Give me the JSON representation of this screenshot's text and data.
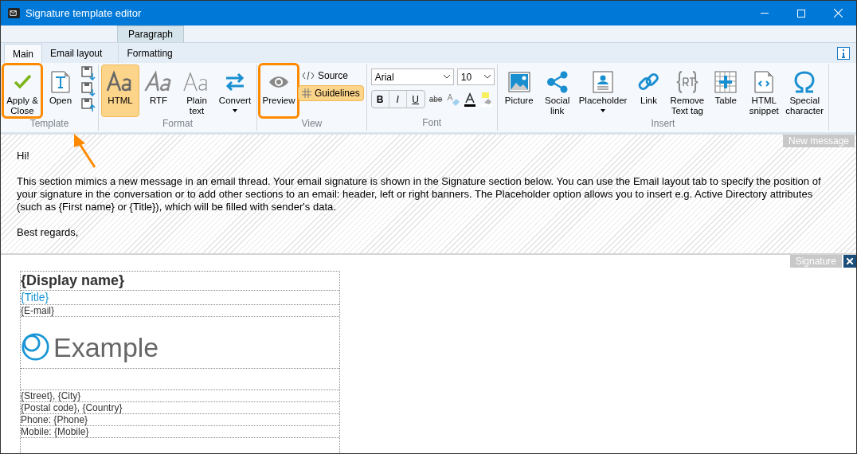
{
  "window": {
    "title": "Signature template editor"
  },
  "context_tab": {
    "label": "Paragraph"
  },
  "tabs": [
    {
      "label": "Main",
      "selected": true
    },
    {
      "label": "Email layout",
      "selected": false
    },
    {
      "label": "Formatting",
      "selected": false
    }
  ],
  "ribbon": [
    {
      "label": "Template",
      "items": [
        {
          "kind": "large",
          "label": "Apply & Close",
          "highlighted": true
        },
        {
          "kind": "large",
          "label": "Open",
          "highlighted": false
        },
        {
          "kind": "stack"
        }
      ]
    },
    {
      "label": "Format",
      "items": [
        {
          "kind": "large",
          "label": "HTML",
          "selected": true
        },
        {
          "kind": "large",
          "label": "RTF",
          "selected": false
        },
        {
          "kind": "large",
          "label": "Plain text",
          "selected": false
        },
        {
          "kind": "dropdown",
          "label": "Convert"
        }
      ]
    },
    {
      "label": "View",
      "items": [
        {
          "kind": "large",
          "label": "Preview",
          "highlighted": true
        },
        {
          "kind": "toggles",
          "toggles": [
            {
              "label": "Source",
              "selected": false
            },
            {
              "label": "Guidelines",
              "selected": true
            }
          ]
        }
      ]
    },
    {
      "label": "Font",
      "items": [
        {
          "kind": "font",
          "font": "Arial",
          "size": "10",
          "styles": [
            "B",
            "I",
            "U"
          ],
          "strike": "abe"
        }
      ]
    },
    {
      "label": "Insert",
      "items": [
        {
          "kind": "large",
          "label": "Picture"
        },
        {
          "kind": "large",
          "label": "Social link"
        },
        {
          "kind": "dropdown",
          "label": "Placeholder"
        },
        {
          "kind": "large",
          "label": "Link"
        },
        {
          "kind": "large",
          "label": "Remove Text tag"
        },
        {
          "kind": "large",
          "label": "Table"
        },
        {
          "kind": "large",
          "label": "HTML snippet"
        },
        {
          "kind": "large",
          "label": "Special character"
        }
      ]
    }
  ],
  "message": {
    "label": "New message",
    "paragraphs": [
      "Hi!",
      "This section mimics a new message in an email thread. Your email signature is shown in the Signature section below. You can use the Email layout tab to specify the position of your signature in the conversation or to add other sections to an email: header, left or right banners. The Placeholder option allows you to insert e.g. Active Directory attributes (such as {First name} or {Title}), which will be filled with sender's data.",
      "Best regards,"
    ]
  },
  "signature": {
    "label": "Signature",
    "rows": [
      {
        "kind": "name",
        "text": "{Display name}"
      },
      {
        "kind": "title",
        "text": "{Title}"
      },
      {
        "kind": "small",
        "text": "{E-mail}"
      },
      {
        "kind": "logo",
        "text": "Example"
      },
      {
        "kind": "blank"
      },
      {
        "kind": "small",
        "text": "{Street}, {City}"
      },
      {
        "kind": "small",
        "text": "{Postal code}, {Country}"
      },
      {
        "kind": "small",
        "text": "Phone: {Phone}"
      },
      {
        "kind": "small",
        "text": "Mobile: {Mobile}"
      },
      {
        "kind": "blank"
      }
    ]
  }
}
